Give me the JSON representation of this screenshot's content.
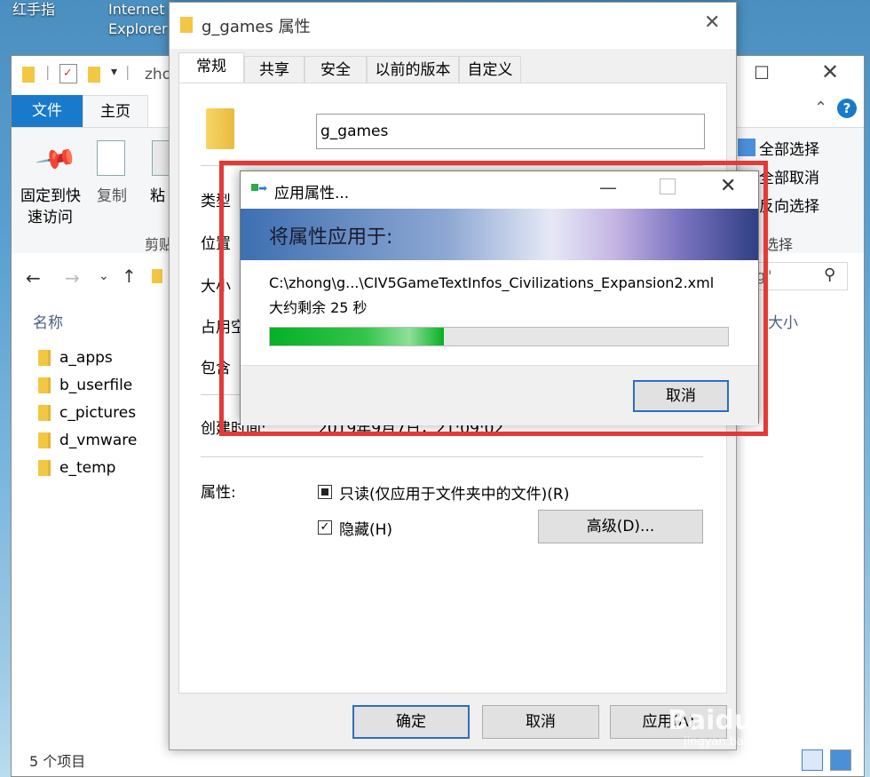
{
  "desktop": {
    "icons": [
      {
        "label": "红手指"
      },
      {
        "label": "Internet"
      },
      {
        "label": "Explorer"
      }
    ]
  },
  "explorer": {
    "title_partial": "zho",
    "ribbon_tabs": [
      "文件",
      "主页"
    ],
    "ribbon": {
      "pin_label_1": "固定到快",
      "pin_label_2": "速访问",
      "copy_label": "复制",
      "paste_label": "粘",
      "clipboard_group": "剪贴",
      "select_all": "全部选择",
      "select_none": "全部取消",
      "invert_selection": "反向选择",
      "select_group": "选择"
    },
    "search_partial": "g\"",
    "column_name": "名称",
    "column_size": "大小",
    "items": [
      "a_apps",
      "b_userfile",
      "c_pictures",
      "d_vmware",
      "e_temp"
    ],
    "status": "5 个项目"
  },
  "props": {
    "title": "g_games 属性",
    "tabs": [
      "常规",
      "共享",
      "安全",
      "以前的版本",
      "自定义"
    ],
    "folder_name": "g_games",
    "labels": {
      "type": "类型",
      "location": "位置",
      "size": "大小",
      "size_on_disk": "占用空",
      "contains": "包含",
      "created": "创建时间:",
      "attributes": "属性:"
    },
    "created_value": "2019年9月7日，21:09:02",
    "readonly_label": "只读(仅应用于文件夹中的文件)(R)",
    "hidden_label": "隐藏(H)",
    "advanced_button": "高级(D)...",
    "ok_button": "确定",
    "cancel_button": "取消",
    "apply_button": "应用(A)"
  },
  "apply_dialog": {
    "title": "应用属性...",
    "header": "将属性应用于:",
    "file_path": "C:\\zhong\\g...\\CIV5GameTextInfos_Civilizations_Expansion2.xml",
    "time_remaining": "大约剩余 25 秒",
    "progress": 0.38,
    "cancel_button": "取消"
  },
  "watermark": {
    "brand": "Baidu经验",
    "url": "jingyan.baidu.com"
  },
  "colors": {
    "highlight": "#e53935",
    "ribbon_file_tab": "#1979ca",
    "progress_green": "#06b025"
  }
}
